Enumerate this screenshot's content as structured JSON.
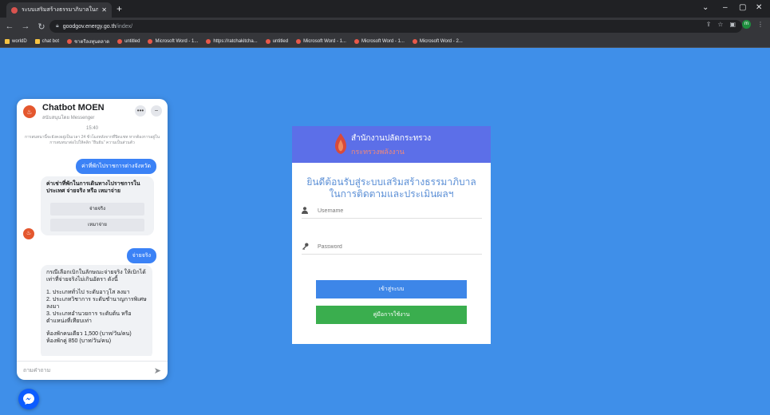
{
  "browser": {
    "tab_title": "ระบบเสริมสร้างธรรมาภิบาลในการติดตาม",
    "url_host": "goodgov.energy.go.th",
    "url_path": "/index/",
    "bookmarks": [
      {
        "label": "worldD",
        "icon": "folder"
      },
      {
        "label": "chat bot",
        "icon": "folder"
      },
      {
        "label": "ชาตรีลงทุนตลาด",
        "icon": "page"
      },
      {
        "label": "untitled",
        "icon": "page"
      },
      {
        "label": "Microsoft Word - 1...",
        "icon": "page"
      },
      {
        "label": "https://ratchakitcha...",
        "icon": "page"
      },
      {
        "label": "untitled",
        "icon": "page"
      },
      {
        "label": "Microsoft Word - 1...",
        "icon": "page"
      },
      {
        "label": "Microsoft Word - 1...",
        "icon": "page"
      },
      {
        "label": "Microsoft Word - 2...",
        "icon": "page"
      }
    ],
    "profile_initial": "m"
  },
  "chat": {
    "title": "Chatbot MOEN",
    "subtitle": "สนับสนุนโดย Messenger",
    "timestamp": "15:40",
    "system_message": "การสนทนานี้จะยังคงอยู่เป็นเวลา 24 ชั่วโมงหลังจากที่ปิดแชท หากต้องการอยู่ในการสนทนาต่อไปให้คลิก \"ยืนยัน\" ความเป็นส่วนตัว",
    "user_msg_1": "ค่าที่พักไปราชการต่างจังหวัด",
    "bot_msg_1": "ค่าเช่าที่พักในการเดินทางไปราชการในประเทศ จ่ายจริง หรือ เหมาจ่าย",
    "quick_replies": [
      "จ่ายจริง",
      "เหมาจ่าย"
    ],
    "user_msg_2": "จ่ายจริง",
    "bot_msg_2_intro": "กรณีเลือกเบิกในลักษณะจ่ายจริง ให้เบิกได้เท่าที่จ่ายจริงไม่เกินอัตรา ดังนี้",
    "bot_msg_2_items": [
      "1. ประเภททั่วไป ระดับอาวุโส ลงมา",
      "2. ประเภทวิชาการ ระดับชำนาญการพิเศษ ลงมา",
      "3. ประเภทอำนวยการ ระดับต้น หรือ ตำแหน่งที่เทียบเท่า"
    ],
    "bot_msg_2_rates": [
      "ห้องพักคนเดียว 1,500 (บาท/วัน/คน)",
      "ห้องพักคู่ 850 (บาท/วัน/คน)"
    ],
    "input_placeholder": "ถามคำถาม"
  },
  "login": {
    "org_line1": "สำนักงานปลัดกระทรวง",
    "org_line2": "กระทรวงพลังงาน",
    "welcome_line1": "ยินดีต้อนรับสู่ระบบเสริมสร้างธรรมาภิบาล",
    "welcome_line2": "ในการติดตามและประเมินผลฯ",
    "username_placeholder": "Username",
    "password_placeholder": "Password",
    "login_button": "เข้าสู่ระบบ",
    "manual_button": "คู่มือการใช้งาน"
  },
  "colors": {
    "page_bg": "#3f8fe9",
    "header_bg": "#5c6fe8",
    "login_btn": "#3d86e8",
    "manual_btn": "#3aae4e",
    "chat_bubble": "#3b82f6"
  }
}
